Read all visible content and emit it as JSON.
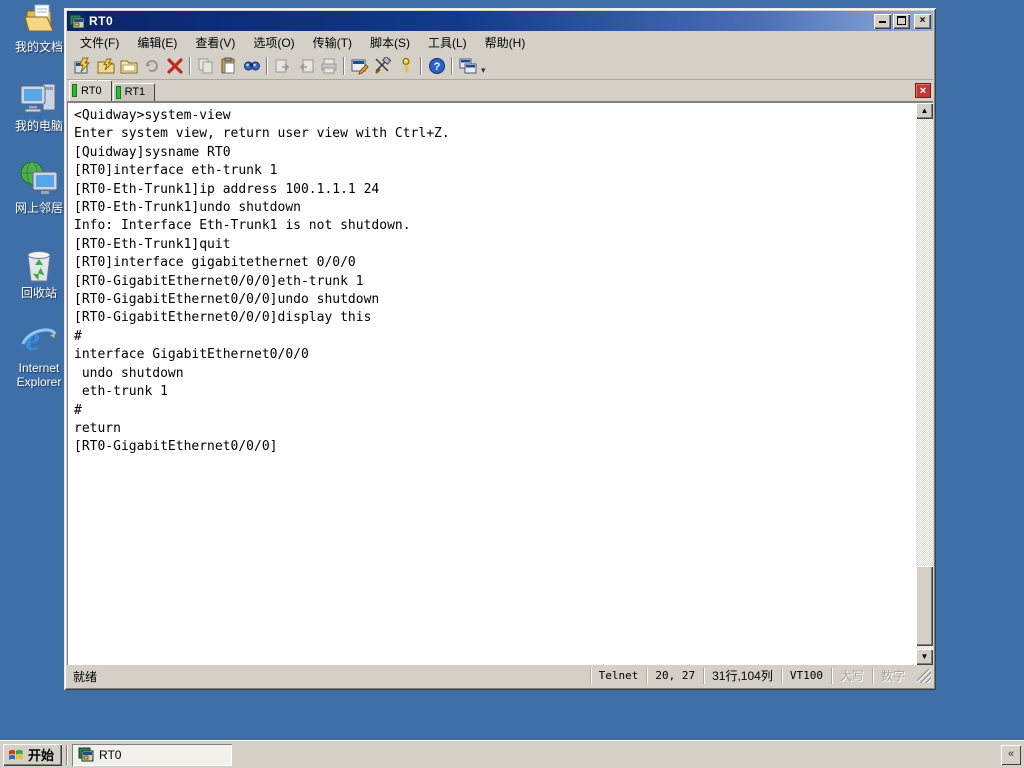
{
  "desktop": {
    "icons": [
      {
        "label": "我的文档"
      },
      {
        "label": "我的电脑"
      },
      {
        "label": "网上邻居"
      },
      {
        "label": "回收站"
      },
      {
        "label": "Internet Explorer"
      }
    ]
  },
  "window": {
    "title": "RT0",
    "controls": {
      "minimize": "minimize",
      "maximize": "maximize",
      "close": "×"
    }
  },
  "menu": {
    "items": [
      "文件(F)",
      "编辑(E)",
      "查看(V)",
      "选项(O)",
      "传输(T)",
      "脚本(S)",
      "工具(L)",
      "帮助(H)"
    ]
  },
  "toolbar": {
    "icons": [
      "quick-connect-icon",
      "connect-icon",
      "sessions-folder-icon",
      "reconnect-icon",
      "disconnect-icon",
      "copy-icon",
      "paste-icon",
      "find-icon",
      "send-file-icon",
      "receive-file-icon",
      "print-icon",
      "session-options-icon",
      "global-options-icon",
      "keygen-icon",
      "help-icon",
      "cascade-windows-icon"
    ]
  },
  "tabs": [
    {
      "label": "RT0",
      "active": true
    },
    {
      "label": "RT1",
      "active": false
    }
  ],
  "tab_close": "×",
  "terminal": {
    "lines": [
      "<Quidway>system-view",
      "Enter system view, return user view with Ctrl+Z.",
      "[Quidway]sysname RT0",
      "[RT0]interface eth-trunk 1",
      "[RT0-Eth-Trunk1]ip address 100.1.1.1 24",
      "[RT0-Eth-Trunk1]undo shutdown",
      "Info: Interface Eth-Trunk1 is not shutdown.",
      "[RT0-Eth-Trunk1]quit",
      "[RT0]interface gigabitethernet 0/0/0",
      "[RT0-GigabitEthernet0/0/0]eth-trunk 1",
      "[RT0-GigabitEthernet0/0/0]undo shutdown",
      "[RT0-GigabitEthernet0/0/0]display this",
      "#",
      "interface GigabitEthernet0/0/0",
      " undo shutdown",
      " eth-trunk 1",
      "#",
      "return",
      "[RT0-GigabitEthernet0/0/0]"
    ]
  },
  "statusbar": {
    "ready": "就绪",
    "protocol": "Telnet",
    "cursor": "20, 27",
    "size": "31行,104列",
    "emulation": "VT100",
    "caps": "大写",
    "num": "数字"
  },
  "taskbar": {
    "start": "开始",
    "task": "RT0",
    "tray_chevron": "«"
  }
}
